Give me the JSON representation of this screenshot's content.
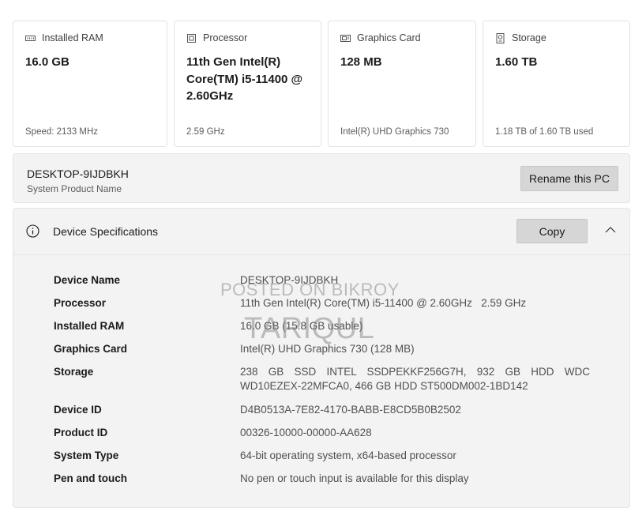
{
  "cards": [
    {
      "icon": "ram-icon",
      "title": "Installed RAM",
      "value": "16.0 GB",
      "foot": "Speed: 2133 MHz"
    },
    {
      "icon": "processor-icon",
      "title": "Processor",
      "value": "11th Gen Intel(R) Core(TM) i5-11400 @ 2.60GHz",
      "foot": "2.59 GHz"
    },
    {
      "icon": "graphics-card-icon",
      "title": "Graphics Card",
      "value": "128 MB",
      "foot": "Intel(R) UHD Graphics 730"
    },
    {
      "icon": "storage-icon",
      "title": "Storage",
      "value": "1.60 TB",
      "foot": "1.18 TB of 1.60 TB used"
    }
  ],
  "pc": {
    "name": "DESKTOP-9IJDBKH",
    "subtitle": "System Product Name",
    "rename_label": "Rename this PC"
  },
  "specs": {
    "title": "Device Specifications",
    "copy_label": "Copy",
    "icons": {
      "info": "info-icon",
      "collapse": "chevron-up-icon"
    },
    "rows": [
      {
        "label": "Device Name",
        "value": "DESKTOP-9IJDBKH"
      },
      {
        "label": "Processor",
        "value": "11th Gen Intel(R) Core(TM) i5-11400 @ 2.60GHz   2.59 GHz"
      },
      {
        "label": "Installed RAM",
        "value": "16.0 GB (15.8 GB usable)"
      },
      {
        "label": "Graphics Card",
        "value": "Intel(R) UHD Graphics 730 (128 MB)"
      },
      {
        "label": "Storage",
        "value": "238 GB SSD INTEL SSDPEKKF256G7H, 932 GB HDD WDC WD10EZEX-22MFCA0, 466 GB HDD ST500DM002-1BD142"
      },
      {
        "label": "Device ID",
        "value": "D4B0513A-7E82-4170-BABB-E8CD5B0B2502"
      },
      {
        "label": "Product ID",
        "value": "00326-10000-00000-AA628"
      },
      {
        "label": "System Type",
        "value": "64-bit operating system, x64-based processor"
      },
      {
        "label": "Pen and touch",
        "value": "No pen or touch input is available for this display"
      }
    ]
  },
  "watermark": {
    "line1": "POSTED ON BIKROY",
    "line2": "TARIQUL"
  }
}
